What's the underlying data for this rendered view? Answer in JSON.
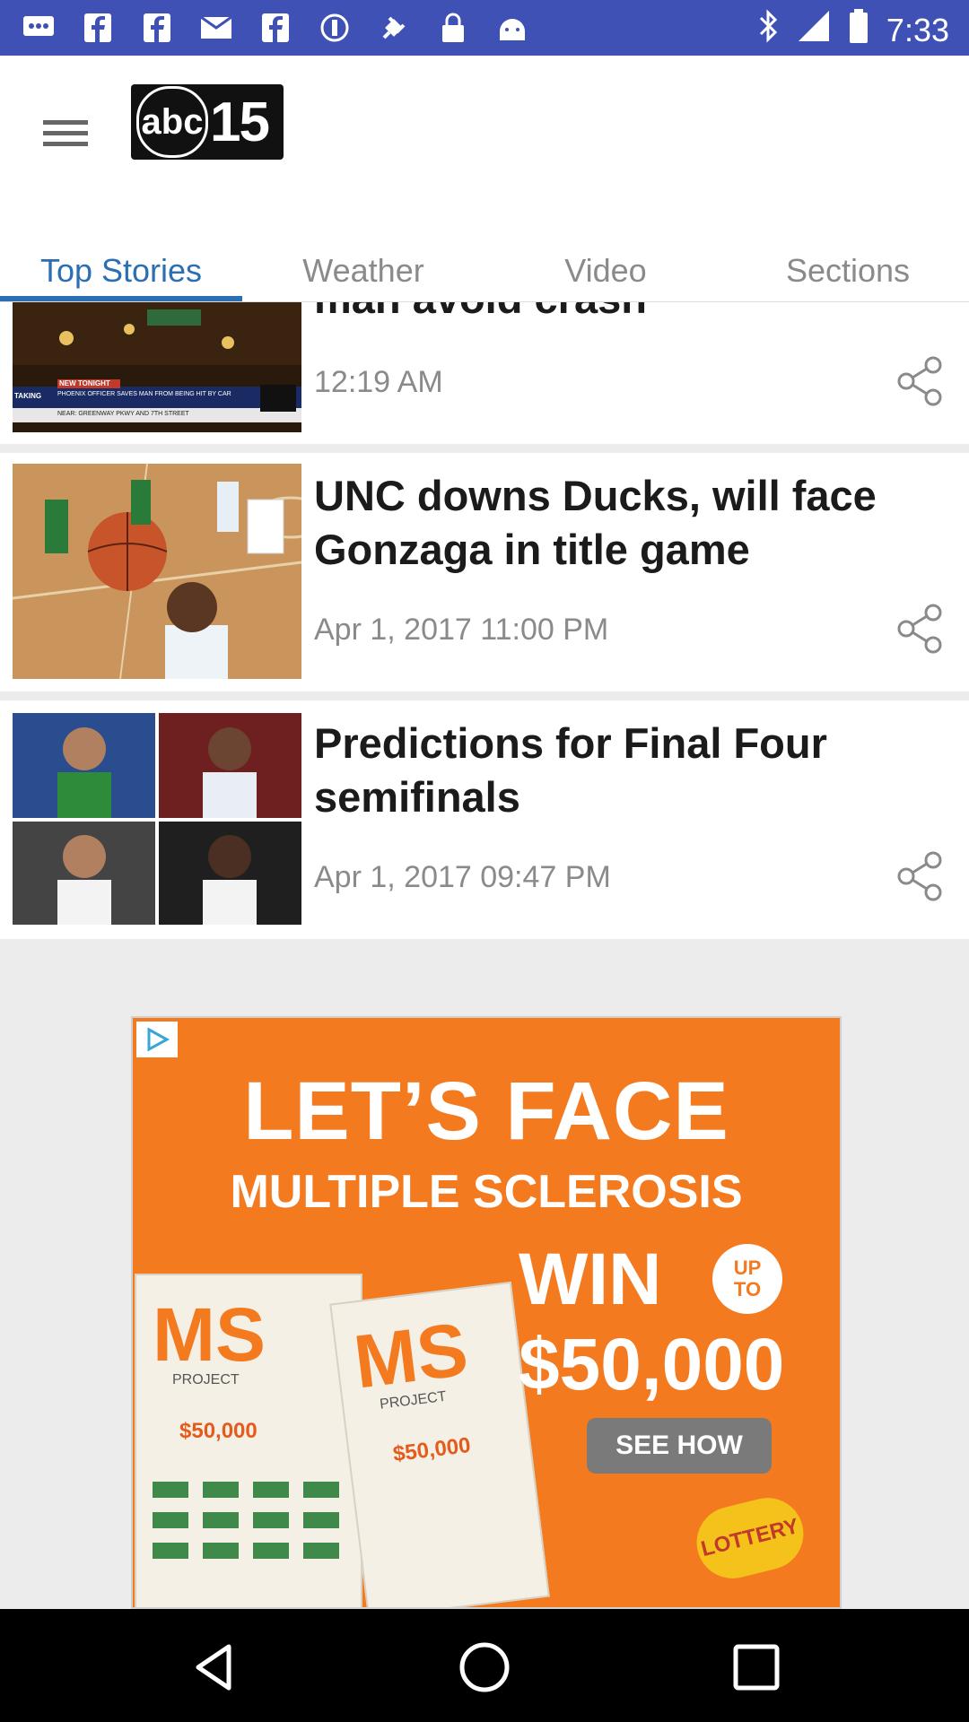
{
  "status_bar": {
    "time": "7:33",
    "left_icons": [
      "message-icon",
      "facebook-icon",
      "facebook-icon",
      "mail-icon",
      "facebook-icon",
      "circle-icon",
      "fake-gps-icon",
      "lock-icon",
      "android-icon"
    ],
    "right_icons": [
      "bluetooth-icon",
      "signal-icon",
      "battery-icon"
    ]
  },
  "header": {
    "logo_abc": "abc",
    "logo_number": "15"
  },
  "tabs": [
    {
      "label": "Top Stories",
      "active": true
    },
    {
      "label": "Weather",
      "active": false
    },
    {
      "label": "Video",
      "active": false
    },
    {
      "label": "Sections",
      "active": false
    }
  ],
  "stories": [
    {
      "title": "man avoid crash",
      "time": "12:19 AM",
      "thumb_caption_tag": "NEW TONIGHT",
      "thumb_caption": "PHOENIX OFFICER SAVES MAN FROM BEING HIT BY CAR",
      "thumb_caption_sub": "NEAR: GREENWAY PKWY AND 7TH STREET",
      "thumb_prefix": "TAKING"
    },
    {
      "title": "UNC downs Ducks, will face Gonzaga in title game",
      "time": "Apr 1, 2017 11:00 PM"
    },
    {
      "title": "Predictions for Final Four semifinals",
      "time": "Apr 1, 2017 09:47 PM"
    }
  ],
  "ad": {
    "headline": "LET’S FACE",
    "subheadline": "MULTIPLE SCLEROSIS",
    "win": "WIN",
    "up": "UP",
    "to": "TO",
    "amount": "$50,000",
    "cta": "SEE HOW",
    "ticket_brand": "MS",
    "ticket_sub": "PROJECT",
    "ticket_prize": "$50,000",
    "lottery": "LOTTERY"
  },
  "colors": {
    "status_bar": "#3f51b5",
    "accent": "#2c6eb3",
    "ad_orange": "#f47a1f"
  }
}
